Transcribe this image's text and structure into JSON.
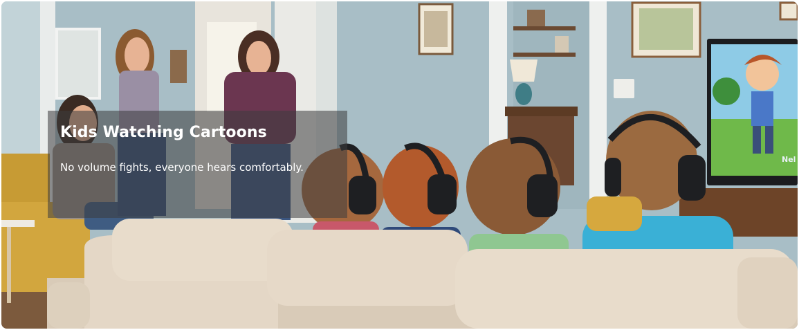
{
  "slide": {
    "title": "Kids Watching Cartoons",
    "caption": "No volume fights, everyone hears comfortably."
  },
  "tv_text": "Nel",
  "colors": {
    "wall": "#a9c0c8",
    "sofa": "#e0d3c3",
    "headphones": "#1e1f22",
    "overlay": "rgba(60,60,62,0.55)",
    "text": "#ffffff"
  },
  "icons": [
    "headphones-icon"
  ]
}
